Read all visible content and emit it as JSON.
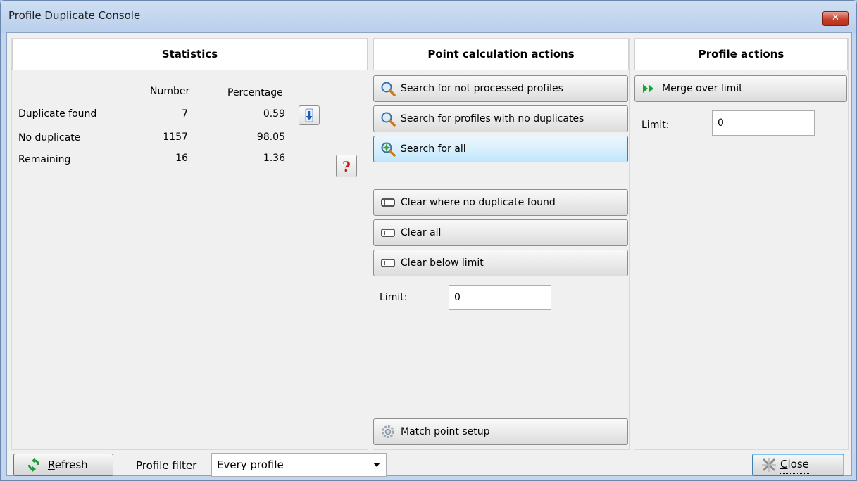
{
  "window": {
    "title": "Profile Duplicate Console",
    "close_glyph": "✕"
  },
  "statistics": {
    "header": "Statistics",
    "col_number": "Number",
    "col_percentage": "Percentage",
    "rows": [
      {
        "label": "Duplicate found",
        "number": "7",
        "percentage": "0.59"
      },
      {
        "label": "No duplicate",
        "number": "1157",
        "percentage": "98.05"
      },
      {
        "label": "Remaining",
        "number": "16",
        "percentage": "1.36"
      }
    ],
    "down_icon": "arrow-down-icon",
    "help_icon": "help-icon"
  },
  "point_actions": {
    "header": "Point calculation actions",
    "search_not_processed": "Search for not processed profiles",
    "search_no_duplicates": "Search for profiles with no duplicates",
    "search_all": "Search for all",
    "clear_no_duplicate": "Clear where no duplicate found",
    "clear_all": "Clear all",
    "clear_below_limit": "Clear below limit",
    "limit_label": "Limit:",
    "limit_value": "0",
    "match_point_setup": "Match point setup"
  },
  "profile_actions": {
    "header": "Profile actions",
    "merge_over_limit": "Merge over limit",
    "limit_label": "Limit:",
    "limit_value": "0"
  },
  "footer": {
    "refresh_first": "R",
    "refresh_rest": "efresh",
    "profile_filter_label": "Profile filter",
    "profile_filter_value": "Every profile",
    "close_first": "C",
    "close_rest": "lose"
  },
  "colors": {
    "accent": "#3c7fb1",
    "title_bar": "#c4d6ee",
    "close_red": "#c6412b"
  }
}
